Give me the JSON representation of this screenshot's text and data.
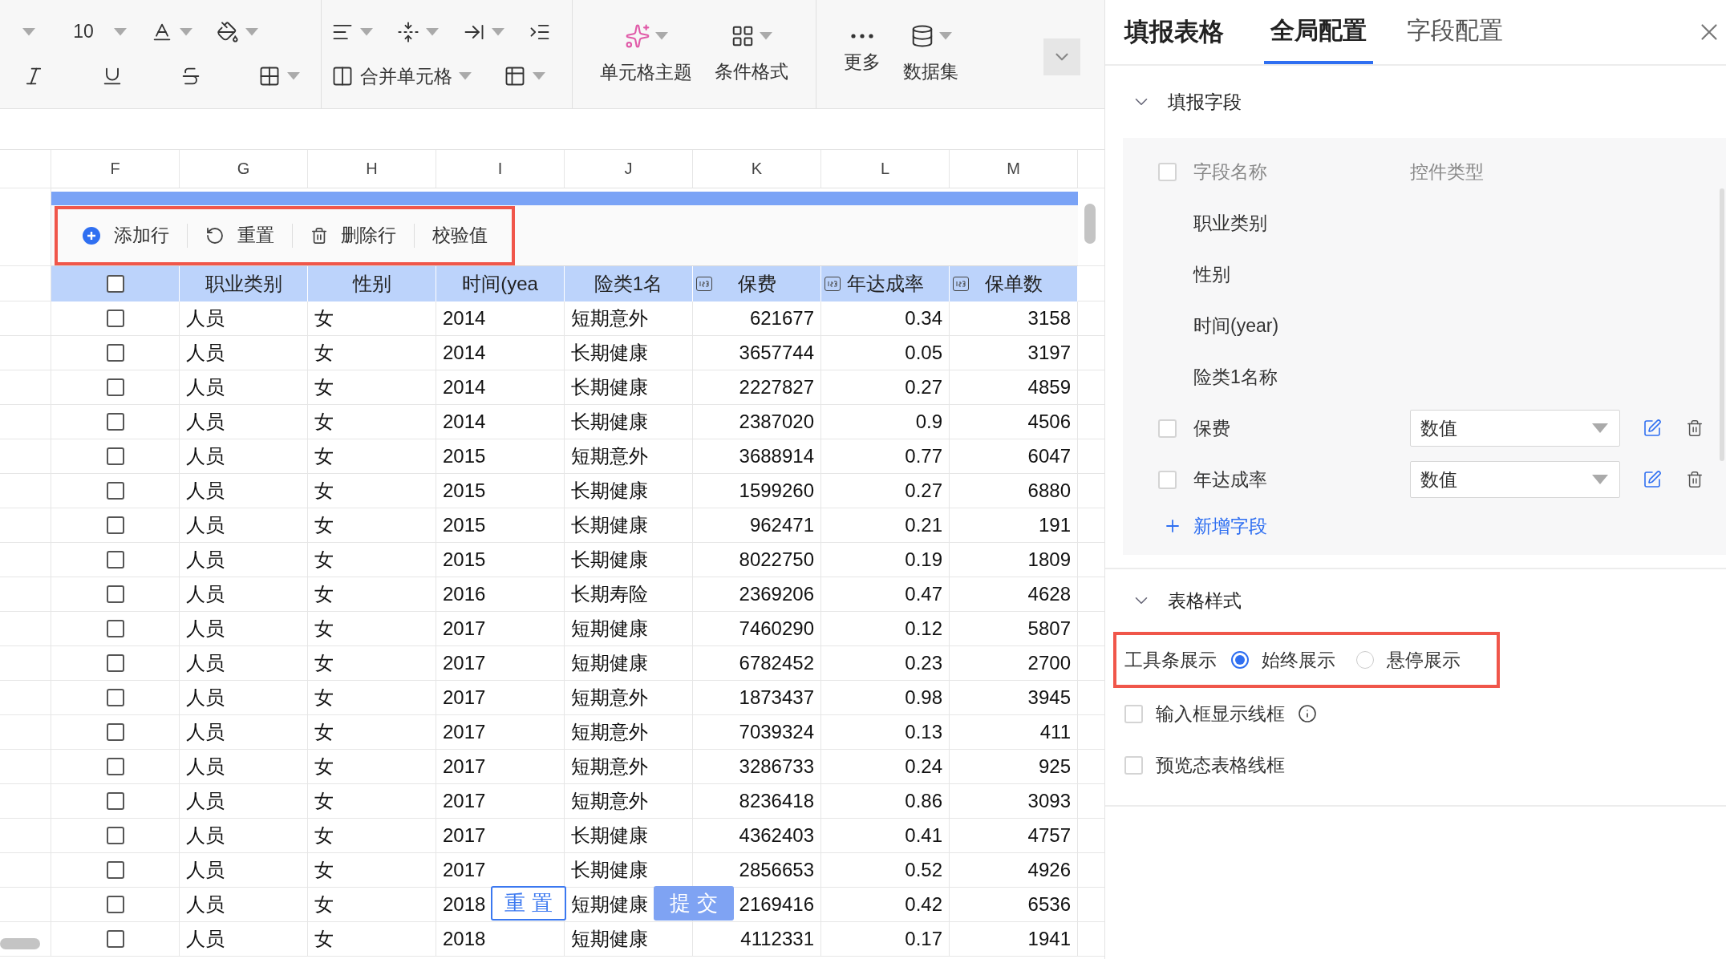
{
  "toolbar": {
    "font_size": "10",
    "merge_label": "合并单元格",
    "buttons": [
      "单元格主题",
      "条件格式",
      "更多",
      "数据集"
    ]
  },
  "sheet": {
    "column_letters": [
      "F",
      "G",
      "H",
      "I",
      "J",
      "K",
      "L",
      "M"
    ]
  },
  "form": {
    "actions_highlighted": true,
    "actions": [
      "添加行",
      "重置",
      "删除行",
      "校验值"
    ],
    "header_checked": false,
    "columns": [
      {
        "label": "职业类别",
        "numeric": false
      },
      {
        "label": "性别",
        "numeric": false
      },
      {
        "label": "时间(yea",
        "numeric": false
      },
      {
        "label": "险类1名",
        "numeric": false
      },
      {
        "label": "保费",
        "numeric": true
      },
      {
        "label": "年达成率",
        "numeric": true
      },
      {
        "label": "保单数",
        "numeric": true
      }
    ],
    "rows": [
      {
        "checked": false,
        "cells": [
          "人员",
          "女",
          "2014",
          "短期意外",
          "621677",
          "0.34",
          "3158"
        ]
      },
      {
        "checked": false,
        "cells": [
          "人员",
          "女",
          "2014",
          "长期健康",
          "3657744",
          "0.05",
          "3197"
        ]
      },
      {
        "checked": false,
        "cells": [
          "人员",
          "女",
          "2014",
          "长期健康",
          "2227827",
          "0.27",
          "4859"
        ]
      },
      {
        "checked": false,
        "cells": [
          "人员",
          "女",
          "2014",
          "长期健康",
          "2387020",
          "0.9",
          "4506"
        ]
      },
      {
        "checked": false,
        "cells": [
          "人员",
          "女",
          "2015",
          "短期意外",
          "3688914",
          "0.77",
          "6047"
        ]
      },
      {
        "checked": false,
        "cells": [
          "人员",
          "女",
          "2015",
          "长期健康",
          "1599260",
          "0.27",
          "6880"
        ]
      },
      {
        "checked": false,
        "cells": [
          "人员",
          "女",
          "2015",
          "长期健康",
          "962471",
          "0.21",
          "191"
        ]
      },
      {
        "checked": false,
        "cells": [
          "人员",
          "女",
          "2015",
          "长期健康",
          "8022750",
          "0.19",
          "1809"
        ]
      },
      {
        "checked": false,
        "cells": [
          "人员",
          "女",
          "2016",
          "长期寿险",
          "2369206",
          "0.47",
          "4628"
        ]
      },
      {
        "checked": false,
        "cells": [
          "人员",
          "女",
          "2017",
          "短期健康",
          "7460290",
          "0.12",
          "5807"
        ]
      },
      {
        "checked": false,
        "cells": [
          "人员",
          "女",
          "2017",
          "短期健康",
          "6782452",
          "0.23",
          "2700"
        ]
      },
      {
        "checked": false,
        "cells": [
          "人员",
          "女",
          "2017",
          "短期意外",
          "1873437",
          "0.98",
          "3945"
        ]
      },
      {
        "checked": false,
        "cells": [
          "人员",
          "女",
          "2017",
          "短期意外",
          "7039324",
          "0.13",
          "411"
        ]
      },
      {
        "checked": false,
        "cells": [
          "人员",
          "女",
          "2017",
          "短期意外",
          "3286733",
          "0.24",
          "925"
        ]
      },
      {
        "checked": false,
        "cells": [
          "人员",
          "女",
          "2017",
          "短期意外",
          "8236418",
          "0.86",
          "3093"
        ]
      },
      {
        "checked": false,
        "cells": [
          "人员",
          "女",
          "2017",
          "长期健康",
          "4362403",
          "0.41",
          "4757"
        ]
      },
      {
        "checked": false,
        "cells": [
          "人员",
          "女",
          "2017",
          "长期健康",
          "2856653",
          "0.52",
          "4926"
        ]
      },
      {
        "checked": false,
        "cells": [
          "人员",
          "女",
          "2018",
          "短期健康",
          "2169416",
          "0.42",
          "6536"
        ]
      },
      {
        "checked": false,
        "cells": [
          "人员",
          "女",
          "2018",
          "短期健康",
          "4112331",
          "0.17",
          "1941"
        ]
      }
    ],
    "floating_buttons": [
      {
        "label": "重 置",
        "kind": "outline"
      },
      {
        "label": "提 交",
        "kind": "primary"
      }
    ]
  },
  "panel": {
    "title": "填报表格",
    "tabs": [
      {
        "label": "全局配置",
        "selected": true
      },
      {
        "label": "字段配置",
        "selected": false
      }
    ],
    "fields_section": {
      "title": "填报字段",
      "expanded": true,
      "header": {
        "checked": false,
        "name": "字段名称",
        "type": "控件类型"
      },
      "items": [
        {
          "kind": "fixed",
          "name": "职业类别"
        },
        {
          "kind": "fixed",
          "name": "性别"
        },
        {
          "kind": "fixed",
          "name": "时间(year)"
        },
        {
          "kind": "fixed",
          "name": "险类1名称"
        },
        {
          "kind": "editable",
          "name": "保费",
          "checked": false,
          "control": "数值"
        },
        {
          "kind": "editable",
          "name": "年达成率",
          "checked": false,
          "control": "数值"
        }
      ],
      "add_label": "新增字段"
    },
    "style_section": {
      "title": "表格样式",
      "expanded": true,
      "toolbar_display": {
        "highlighted": true,
        "label": "工具条展示",
        "options": [
          {
            "label": "始终展示",
            "selected": true
          },
          {
            "label": "悬停展示",
            "selected": false
          }
        ]
      },
      "checkboxes": [
        {
          "label": "输入框显示线框",
          "checked": false,
          "info": true
        },
        {
          "label": "预览态表格线框",
          "checked": false,
          "info": false
        }
      ]
    }
  }
}
